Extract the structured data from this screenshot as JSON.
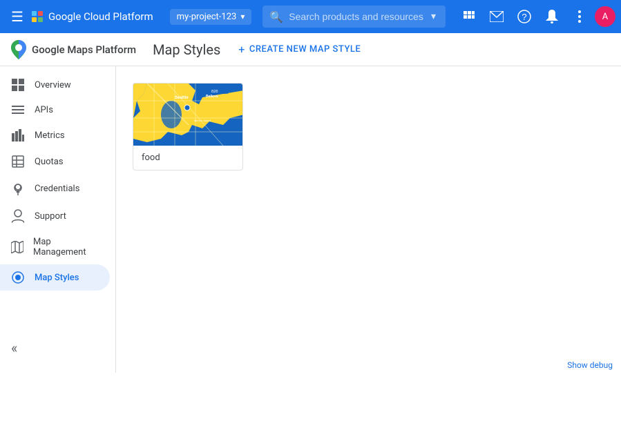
{
  "header": {
    "gcp_title": "Google Cloud Platform",
    "project_name": "my-project-123",
    "search_placeholder": "Search products and resources",
    "menu_icon": "☰"
  },
  "sub_header": {
    "brand": "Google Maps Platform",
    "page_title": "Map Styles",
    "create_btn_label": "CREATE NEW MAP STYLE"
  },
  "sidebar": {
    "items": [
      {
        "id": "overview",
        "label": "Overview",
        "icon": "⊞"
      },
      {
        "id": "apis",
        "label": "APIs",
        "icon": "≡"
      },
      {
        "id": "metrics",
        "label": "Metrics",
        "icon": "▐"
      },
      {
        "id": "quotas",
        "label": "Quotas",
        "icon": "□"
      },
      {
        "id": "credentials",
        "label": "Credentials",
        "icon": "⚿"
      },
      {
        "id": "support",
        "label": "Support",
        "icon": "👤"
      },
      {
        "id": "map-management",
        "label": "Map Management",
        "icon": "🗺"
      },
      {
        "id": "map-styles",
        "label": "Map Styles",
        "icon": "◉",
        "active": true
      }
    ],
    "collapse_icon": "«"
  },
  "map_styles": {
    "cards": [
      {
        "id": "food-style",
        "label": "food",
        "thumbnail_alt": "Seattle map with blue and yellow theme"
      }
    ]
  },
  "debug_bar": {
    "label": "Show debug"
  },
  "icons": {
    "menu": "☰",
    "search": "🔍",
    "notifications": "🔔",
    "help": "?",
    "apps": "⋮⋮",
    "more_vert": "⋮",
    "add": "+"
  },
  "colors": {
    "primary_blue": "#1a73e8",
    "active_blue": "#e8f0fe",
    "active_text": "#1a73e8",
    "sidebar_icon": "#5f6368"
  }
}
